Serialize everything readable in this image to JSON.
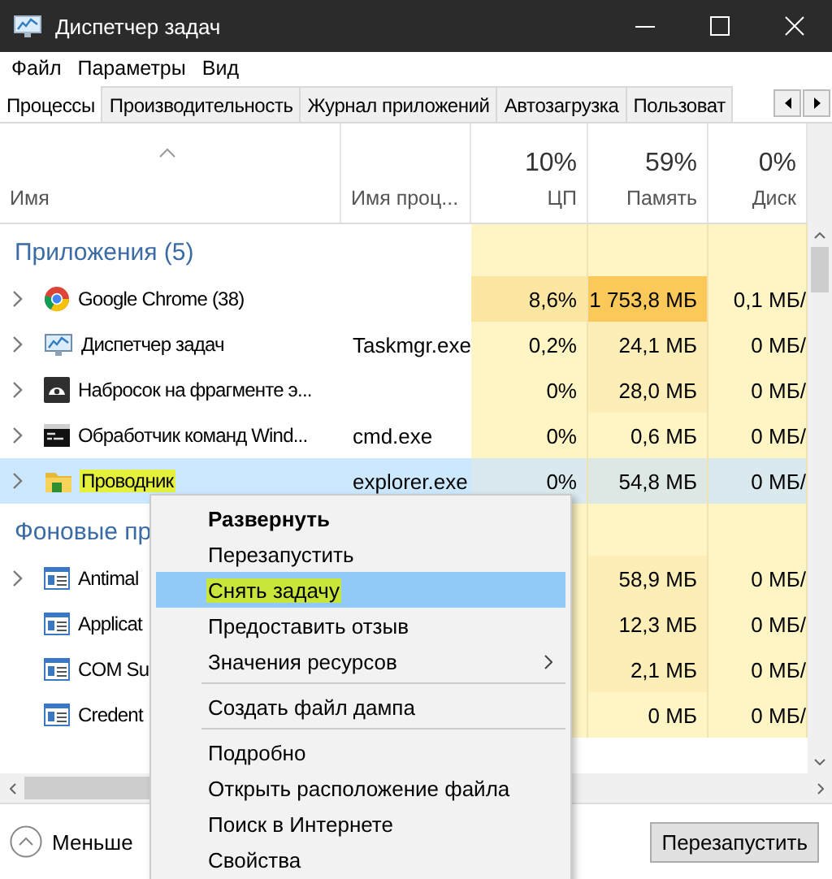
{
  "window": {
    "title": "Диспетчер задач"
  },
  "menu_bar": [
    "Файл",
    "Параметры",
    "Вид"
  ],
  "tabs": [
    {
      "label": "Процессы",
      "selected": true
    },
    {
      "label": "Производительность",
      "selected": false
    },
    {
      "label": "Журнал приложений",
      "selected": false
    },
    {
      "label": "Автозагрузка",
      "selected": false
    },
    {
      "label": "Пользоват",
      "selected": false
    }
  ],
  "columns": [
    {
      "label": "Имя",
      "sorted": true
    },
    {
      "label": "Имя проц...",
      "sorted": false
    },
    {
      "usage": "10%",
      "label": "ЦП",
      "sorted": false
    },
    {
      "usage": "59%",
      "label": "Память",
      "sorted": false
    },
    {
      "usage": "0%",
      "label": "Диск",
      "sorted": false
    }
  ],
  "groups": [
    {
      "title": "Приложения (5)",
      "rows": [
        {
          "kind": "chrome",
          "name": "Google Chrome (38)",
          "expandable": true,
          "selected": false,
          "marked": false,
          "cpu": {
            "text": "8,6%",
            "color": "#fce7a2"
          },
          "memory": {
            "text": "1 753,8 МБ",
            "color": "#fbc85a"
          },
          "disk": {
            "text": "0,1 МБ/",
            "color": "#fff4c4"
          }
        },
        {
          "kind": "monitor",
          "name": "Диспетчер задач",
          "process": "Taskmgr.exe",
          "expandable": true,
          "selected": false,
          "marked": false,
          "cpu": {
            "text": "0,2%",
            "color": "#fff4c4"
          },
          "memory": {
            "text": "24,1 МБ",
            "color": "#fdedb6"
          },
          "disk": {
            "text": "0 МБ/",
            "color": "#fff4c4"
          }
        },
        {
          "kind": "snip",
          "name": "Набросок на фрагменте э...",
          "expandable": true,
          "selected": false,
          "marked": false,
          "cpu": {
            "text": "0%",
            "color": "#fff4c4"
          },
          "memory": {
            "text": "28,0 МБ",
            "color": "#fdedb6"
          },
          "disk": {
            "text": "0 МБ/",
            "color": "#fff4c4"
          }
        },
        {
          "kind": "console",
          "name": "Обработчик команд Wind...",
          "process": "cmd.exe",
          "expandable": true,
          "selected": false,
          "marked": false,
          "cpu": {
            "text": "0%",
            "color": "#fff4c4"
          },
          "memory": {
            "text": "0,6 МБ",
            "color": "#fff4c4"
          },
          "disk": {
            "text": "0 МБ/",
            "color": "#fff4c4"
          }
        },
        {
          "kind": "folder",
          "name": "Проводник",
          "process": "explorer.exe",
          "expandable": true,
          "selected": true,
          "marked": true,
          "cpu": {
            "text": "0%",
            "color": "#d9e9ee"
          },
          "memory": {
            "text": "54,8 МБ",
            "color": "#dde8e4"
          },
          "disk": {
            "text": "0 МБ/",
            "color": "#d9e9ee"
          }
        }
      ]
    },
    {
      "title": "Фоновые пр",
      "rows": [
        {
          "kind": "service",
          "name": "Antimal",
          "expandable": true,
          "selected": false,
          "marked": false,
          "memory": {
            "text": "58,9 МБ",
            "color": "#fdedb6"
          },
          "disk": {
            "text": "0 МБ/",
            "color": "#fff4c4"
          }
        },
        {
          "kind": "service",
          "name": "Applicat",
          "expandable": false,
          "selected": false,
          "marked": false,
          "memory": {
            "text": "12,3 МБ",
            "color": "#fdedb6"
          },
          "disk": {
            "text": "0 МБ/",
            "color": "#fff4c4"
          }
        },
        {
          "kind": "service",
          "name": "COM Su",
          "expandable": false,
          "selected": false,
          "marked": false,
          "memory": {
            "text": "2,1 МБ",
            "color": "#fdedb6"
          },
          "disk": {
            "text": "0 МБ/",
            "color": "#fff4c4"
          }
        },
        {
          "kind": "service",
          "name": "Credent",
          "expandable": false,
          "selected": false,
          "marked": false,
          "memory": {
            "text": "0 МБ",
            "color": "#fff4c4"
          },
          "disk": {
            "text": "0 МБ/",
            "color": "#fff4c4"
          }
        }
      ]
    }
  ],
  "context_menu": {
    "items": [
      {
        "kind": "item",
        "label": "Развернуть",
        "default": true,
        "selected": false,
        "marked": false,
        "submenu": false
      },
      {
        "kind": "item",
        "label": "Перезапустить",
        "default": false,
        "selected": false,
        "marked": false,
        "submenu": false
      },
      {
        "kind": "item",
        "label": "Снять задачу",
        "default": false,
        "selected": true,
        "marked": true,
        "submenu": false
      },
      {
        "kind": "item",
        "label": "Предоставить отзыв",
        "default": false,
        "selected": false,
        "marked": false,
        "submenu": false
      },
      {
        "kind": "item",
        "label": "Значения ресурсов",
        "default": false,
        "selected": false,
        "marked": false,
        "submenu": true
      },
      {
        "kind": "separator"
      },
      {
        "kind": "item",
        "label": "Создать файл дампа",
        "default": false,
        "selected": false,
        "marked": false,
        "submenu": false
      },
      {
        "kind": "separator"
      },
      {
        "kind": "item",
        "label": "Подробно",
        "default": false,
        "selected": false,
        "marked": false,
        "submenu": false
      },
      {
        "kind": "item",
        "label": "Открыть расположение файла",
        "default": false,
        "selected": false,
        "marked": false,
        "submenu": false
      },
      {
        "kind": "item",
        "label": "Поиск в Интернете",
        "default": false,
        "selected": false,
        "marked": false,
        "submenu": false
      },
      {
        "kind": "item",
        "label": "Свойства",
        "default": false,
        "selected": false,
        "marked": false,
        "submenu": false
      }
    ]
  },
  "footer": {
    "toggle": "Меньше",
    "button": "Перезапустить"
  }
}
